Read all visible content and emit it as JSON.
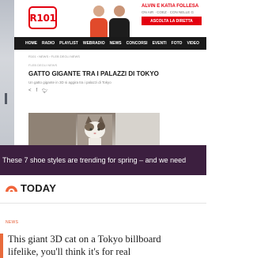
{
  "r101": {
    "logo_text": "R101",
    "onair": {
      "name": "ALVIN E KATIA FOLLESA",
      "sub": "ON AIR · COEZ · CON NELLE G",
      "button": "ASCOLTA LA DIRETTA"
    },
    "nav": [
      "HOME",
      "RADIO",
      "PLAYLIST",
      "WEBRADIO",
      "NEWS",
      "CONCORSI",
      "EVENTI",
      "FOTO",
      "VIDEO"
    ],
    "breadcrumb": "R101 › NEWS › FLEB DEGLI NEWS",
    "article": {
      "kicker": "FLEB DEGLI NEWS",
      "title": "GATTO GIGANTE TRA I PALAZZI DI TOKYO",
      "subtitle": "Un gatto gigante in 3D si aggira tra i palazzi di Tokyo",
      "share_icons": [
        "share-icon",
        "facebook-icon",
        "twitter-icon"
      ]
    }
  },
  "banner": {
    "text": "These 7 shoe styles are trending for spring – and we need",
    "color": "#3c1f3f"
  },
  "today": {
    "logo": "TODAY",
    "kicker": "NEWS",
    "title_line1": "This giant 3D cat on a Tokyo billboard",
    "title_line2": "lifelike, you'll think it's for real",
    "accent": "#e86a3b"
  }
}
